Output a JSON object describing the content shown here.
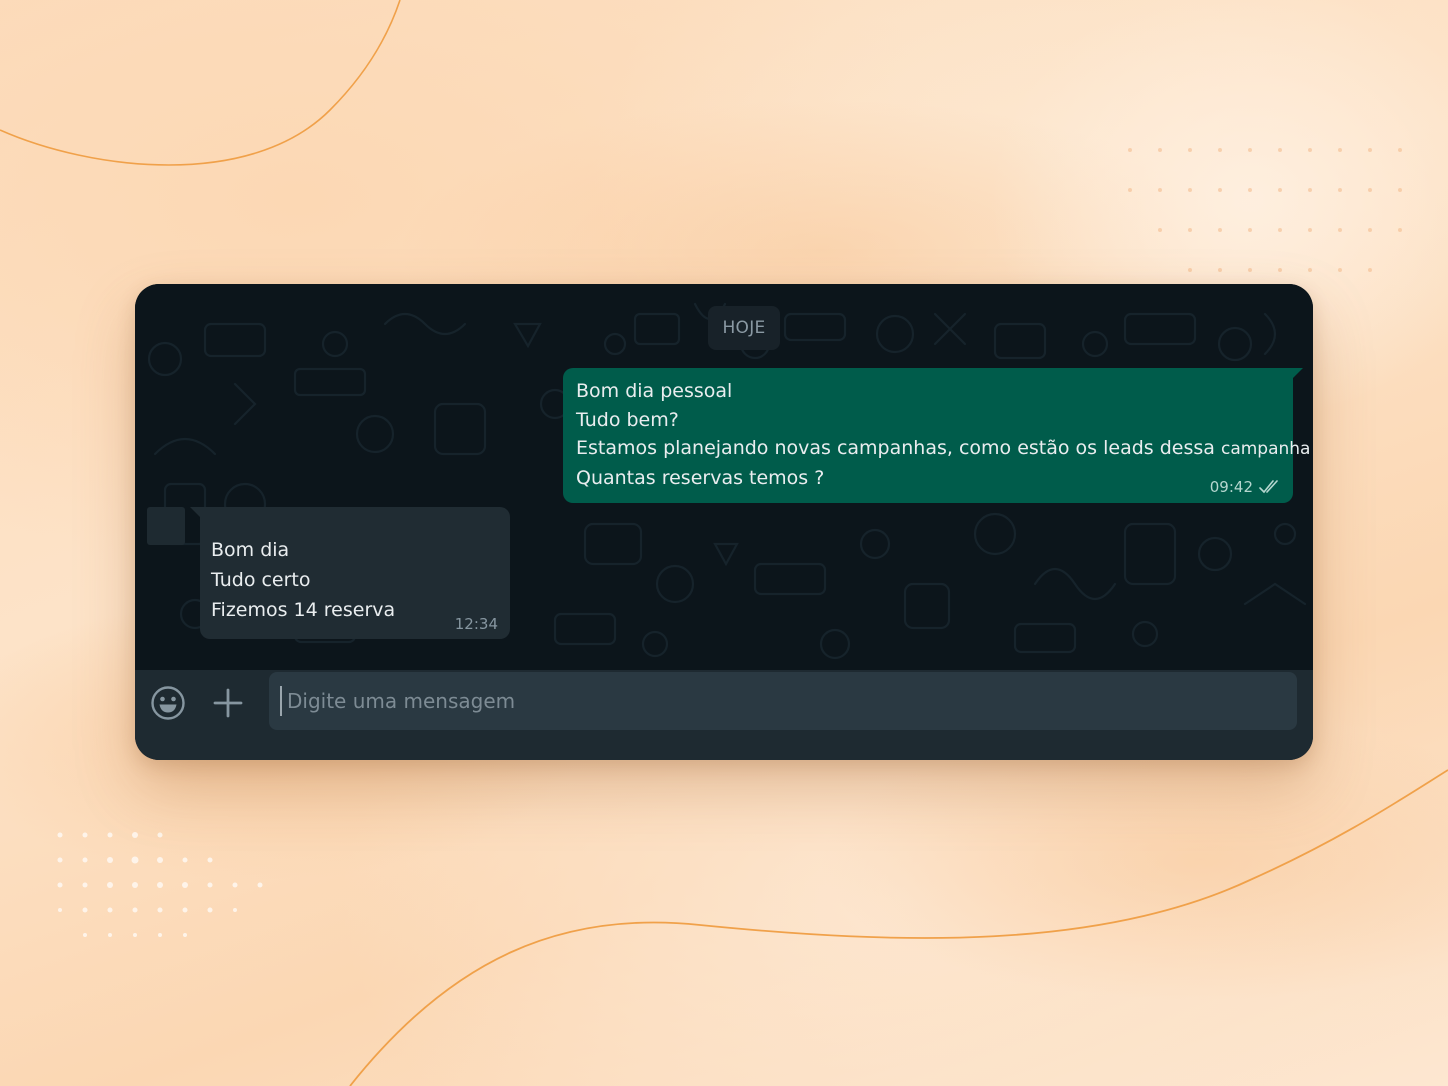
{
  "chat": {
    "day_label": "HOJE",
    "outgoing": {
      "lines": [
        "Bom dia pessoal",
        "Tudo bem?",
        "Estamos planejando novas campanhas, como estão os leads dessa ",
        "campanha atual?",
        "Quantas reservas temos ?"
      ],
      "time": "09:42",
      "status_icon": "double-check-icon"
    },
    "incoming": {
      "lines": [
        "Bom dia",
        "Tudo certo",
        "Fizemos 14 reserva"
      ],
      "time": "12:34"
    }
  },
  "composer": {
    "placeholder": "Digite uma mensagem",
    "emoji_icon": "emoji-icon",
    "attach_icon": "plus-icon"
  },
  "colors": {
    "outgoing_bubble": "#005c4b",
    "incoming_bubble": "#202c33",
    "chat_background": "#0c151b",
    "footer": "#1e2a31"
  }
}
